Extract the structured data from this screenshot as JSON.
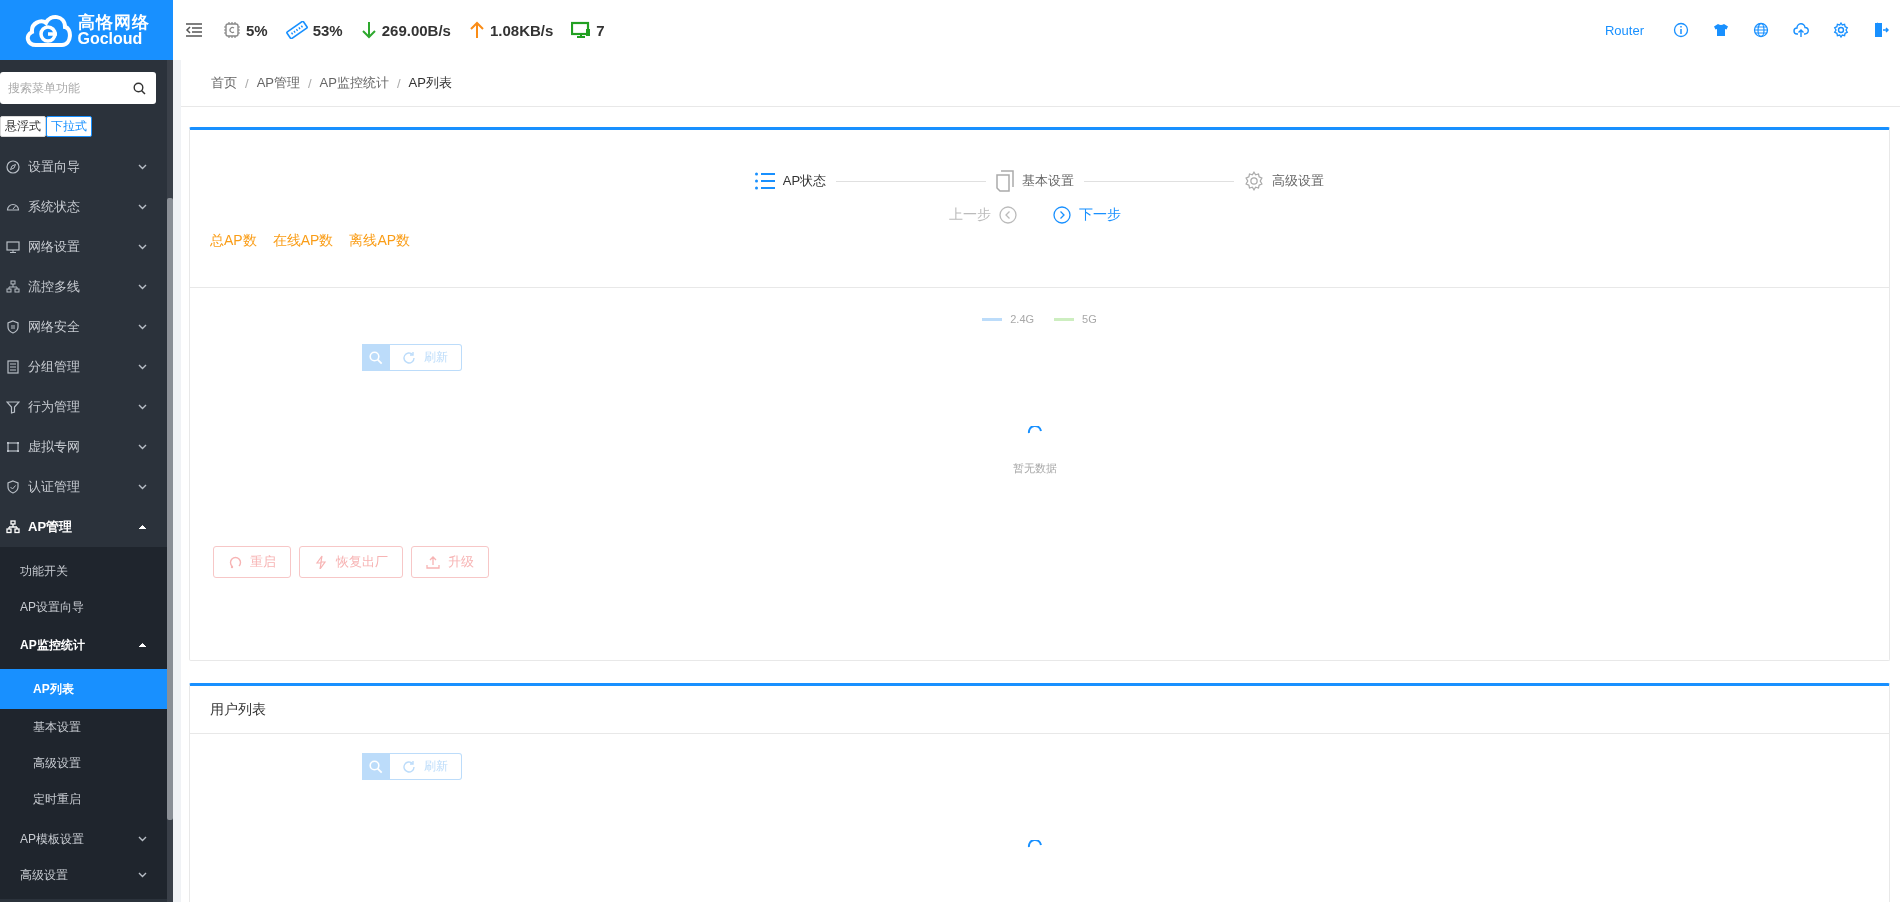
{
  "header": {
    "logo": {
      "name": "高恪网络",
      "sub": "Gocloud"
    },
    "stats": [
      {
        "kind": "cpu",
        "value": "5%"
      },
      {
        "kind": "memory",
        "value": "53%"
      },
      {
        "kind": "download",
        "value": "269.00B/s"
      },
      {
        "kind": "upload",
        "value": "1.08KB/s"
      },
      {
        "kind": "devices",
        "value": "7"
      }
    ],
    "router_link": "Router"
  },
  "sidebar": {
    "search": {
      "placeholder": "搜索菜单功能"
    },
    "mode_toggle": [
      {
        "label": "悬浮式",
        "selected": false
      },
      {
        "label": "下拉式",
        "selected": true
      }
    ],
    "menu": [
      {
        "label": "设置向导",
        "expanded": false,
        "selected": false
      },
      {
        "label": "系统状态",
        "expanded": false,
        "selected": false
      },
      {
        "label": "网络设置",
        "expanded": false,
        "selected": false
      },
      {
        "label": "流控多线",
        "expanded": false,
        "selected": false
      },
      {
        "label": "网络安全",
        "expanded": false,
        "selected": false
      },
      {
        "label": "分组管理",
        "expanded": false,
        "selected": false
      },
      {
        "label": "行为管理",
        "expanded": false,
        "selected": false
      },
      {
        "label": "虚拟专网",
        "expanded": false,
        "selected": false
      },
      {
        "label": "认证管理",
        "expanded": false,
        "selected": false
      },
      {
        "label": "AP管理",
        "expanded": true,
        "selected": false,
        "children": [
          {
            "label": "功能开关",
            "selected": false
          },
          {
            "label": "AP设置向导",
            "selected": false
          },
          {
            "label": "AP监控统计",
            "expanded": true,
            "selected": false,
            "children": [
              {
                "label": "AP列表",
                "selected": true
              },
              {
                "label": "基本设置",
                "selected": false
              },
              {
                "label": "高级设置",
                "selected": false
              },
              {
                "label": "定时重启",
                "selected": false
              }
            ]
          },
          {
            "label": "AP模板设置",
            "expanded": false,
            "selected": false
          },
          {
            "label": "高级设置",
            "expanded": false,
            "selected": false
          }
        ]
      }
    ]
  },
  "breadcrumb": {
    "separator": "/",
    "items": [
      "首页",
      "AP管理",
      "AP监控统计",
      "AP列表"
    ]
  },
  "ap_card": {
    "steps": [
      {
        "label": "AP状态",
        "selected": true
      },
      {
        "label": "基本设置",
        "selected": false
      },
      {
        "label": "高级设置",
        "selected": false
      }
    ],
    "prev": {
      "label": "上一步",
      "disabled": true
    },
    "next": {
      "label": "下一步",
      "disabled": false
    },
    "summary": [
      "总AP数",
      "在线AP数",
      "离线AP数"
    ],
    "legend": [
      {
        "label": "2.4G",
        "color": "#bcdcfa"
      },
      {
        "label": "5G",
        "color": "#cdeec0"
      }
    ],
    "refresh": "刷新",
    "empty_text": "暂无数据",
    "actions": [
      {
        "kind": "restart",
        "label": "重启",
        "disabled": true
      },
      {
        "kind": "reset",
        "label": "恢复出厂",
        "disabled": true
      },
      {
        "kind": "upgrade",
        "label": "升级",
        "disabled": true
      }
    ]
  },
  "user_card": {
    "title": "用户列表",
    "refresh": "刷新"
  }
}
